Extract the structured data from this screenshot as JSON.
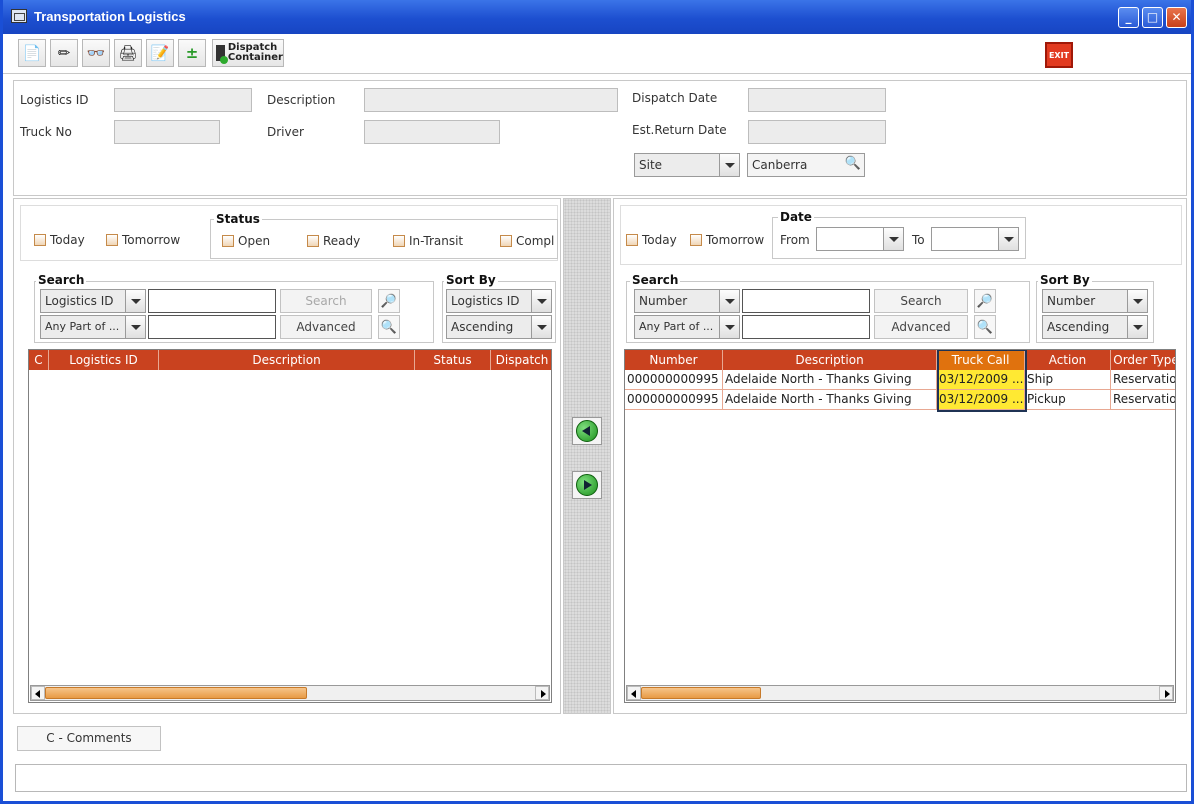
{
  "window": {
    "title": "Transportation Logistics"
  },
  "toolbar": {
    "tools": [
      "new-icon",
      "edit-icon",
      "binoculars-icon",
      "print-icon",
      "notepad-icon",
      "add-remove-icon"
    ],
    "dispatch_label_1": "Dispatch",
    "dispatch_label_2": "Container",
    "exit_label": "EXIT"
  },
  "header": {
    "logistics_id_label": "Logistics ID",
    "description_label": "Description",
    "dispatch_date_label": "Dispatch Date",
    "truck_no_label": "Truck No",
    "driver_label": "Driver",
    "est_return_label": "Est.Return Date",
    "site_selected": "Site",
    "site_value": "Canberra"
  },
  "left": {
    "today_label": "Today",
    "tomorrow_label": "Tomorrow",
    "status_title": "Status",
    "status_options": [
      "Open",
      "Ready",
      "In-Transit",
      "Compl"
    ],
    "search_title": "Search",
    "search_field": "Logistics ID",
    "search_match": "Any Part of ...",
    "search_button": "Search",
    "advanced_button": "Advanced",
    "sort_title": "Sort By",
    "sort_field": "Logistics ID",
    "sort_order": "Ascending",
    "columns": [
      "C",
      "Logistics ID",
      "Description",
      "Status",
      "Dispatch"
    ]
  },
  "right": {
    "today_label": "Today",
    "tomorrow_label": "Tomorrow",
    "date_title": "Date",
    "from_label": "From",
    "to_label": "To",
    "search_title": "Search",
    "search_field": "Number",
    "search_match": "Any Part of ...",
    "search_button": "Search",
    "advanced_button": "Advanced",
    "sort_title": "Sort By",
    "sort_field": "Number",
    "sort_order": "Ascending",
    "columns": [
      "Number",
      "Description",
      "Truck Call",
      "Action",
      "Order Type"
    ],
    "rows": [
      [
        "000000000995",
        "Adelaide North - Thanks Giving",
        "03/12/2009 ...",
        "Ship",
        "Reservation"
      ],
      [
        "000000000995",
        "Adelaide North - Thanks Giving",
        "03/12/2009 ...",
        "Pickup",
        "Reservation"
      ]
    ]
  },
  "footer": {
    "comments_button": "C - Comments"
  }
}
